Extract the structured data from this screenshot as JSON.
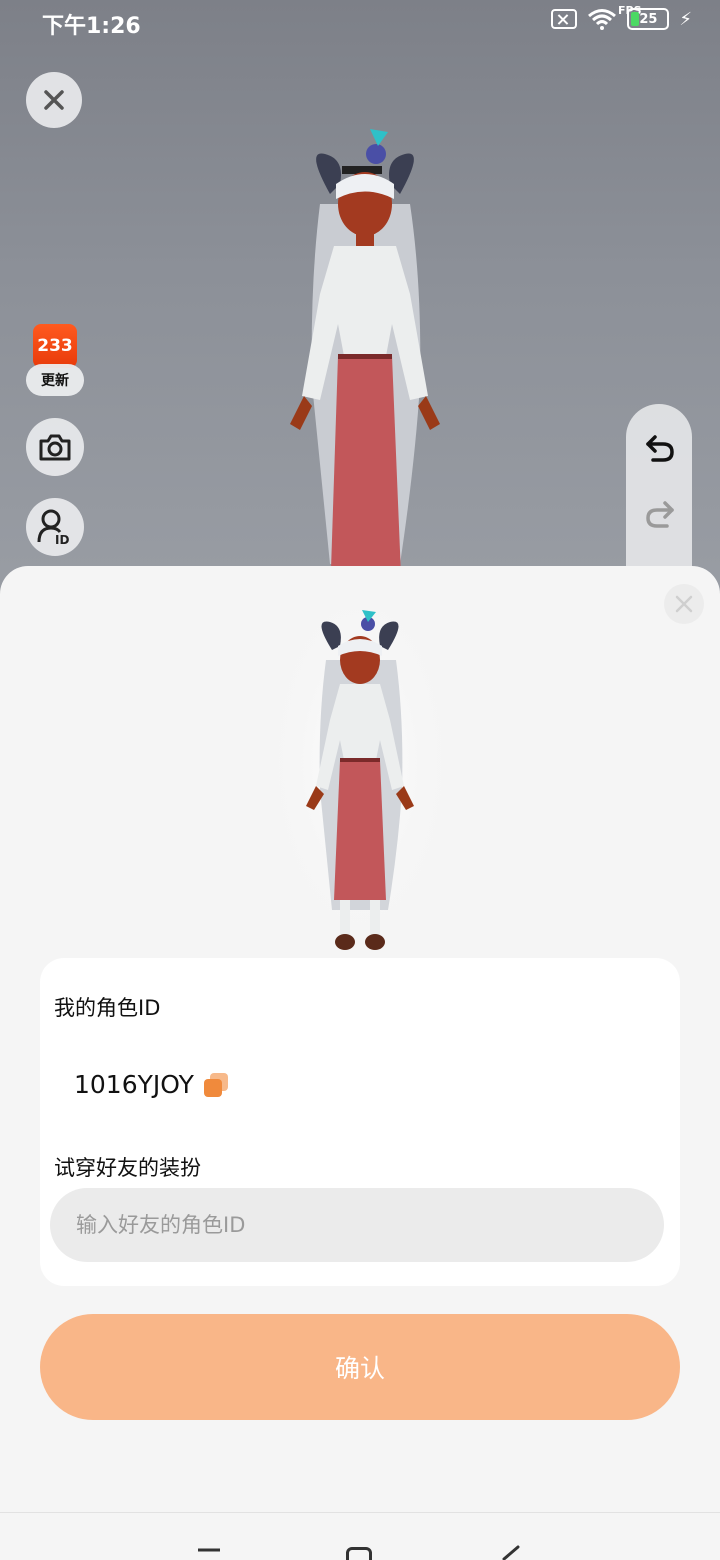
{
  "status_bar": {
    "time": "下午1:26",
    "battery_level": "25",
    "fps_label": "FPS"
  },
  "scene": {
    "app_badge_text": "233",
    "app_update_label": "更新"
  },
  "sheet": {
    "my_id_label": "我的角色ID",
    "my_id_value": "1016YJOY",
    "try_on_label": "试穿好友的装扮",
    "friend_id_placeholder": "输入好友的角色ID",
    "confirm_label": "确认"
  },
  "colors": {
    "accent": "#f9b688",
    "copy_icon": "#f08a3c",
    "app_badge": "#ff5a1f"
  }
}
